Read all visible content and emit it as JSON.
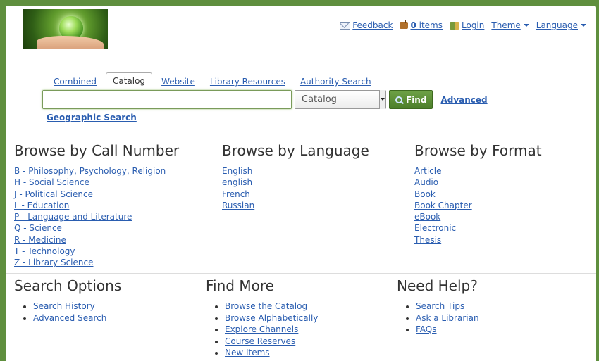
{
  "header": {
    "nav": {
      "feedback": "Feedback",
      "cart_count": "0",
      "cart_label": "items",
      "login": "Login",
      "theme": "Theme",
      "language": "Language"
    }
  },
  "search": {
    "tabs": [
      "Combined",
      "Catalog",
      "Website",
      "Library Resources",
      "Authority Search"
    ],
    "active_tab": "Catalog",
    "input_value": "",
    "scope_selected": "Catalog",
    "find_label": "Find",
    "advanced_label": "Advanced",
    "geo_label": "Geographic Search"
  },
  "browse": {
    "call_number": {
      "title": "Browse by Call Number",
      "items": [
        "B - Philosophy, Psychology, Religion",
        "H - Social Science",
        "J - Political Science",
        "L - Education",
        "P - Language and Literature",
        "Q - Science",
        "R - Medicine",
        "T - Technology",
        "Z - Library Science"
      ]
    },
    "language": {
      "title": "Browse by Language",
      "items": [
        "English",
        "english",
        "French",
        "Russian"
      ]
    },
    "format": {
      "title": "Browse by Format",
      "items": [
        "Article",
        "Audio",
        "Book",
        "Book Chapter",
        "eBook",
        "Electronic",
        "Thesis"
      ]
    }
  },
  "bottom": {
    "search_options": {
      "title": "Search Options",
      "items": [
        "Search History",
        "Advanced Search"
      ]
    },
    "find_more": {
      "title": "Find More",
      "items": [
        "Browse the Catalog",
        "Browse Alphabetically",
        "Explore Channels",
        "Course Reserves",
        "New Items"
      ]
    },
    "need_help": {
      "title": "Need Help?",
      "items": [
        "Search Tips",
        "Ask a Librarian",
        "FAQs"
      ]
    }
  }
}
